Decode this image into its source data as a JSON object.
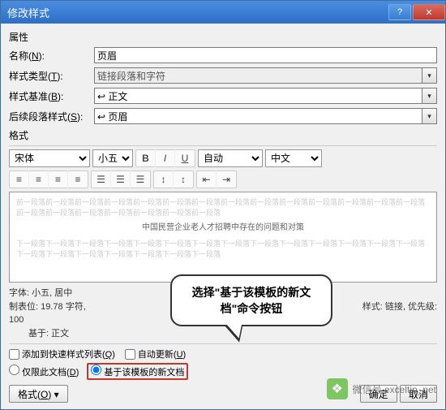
{
  "titlebar": {
    "title": "修改样式"
  },
  "labels": {
    "prop": "属性",
    "name": "名称(N):",
    "styleType": "样式类型(T):",
    "basedOn": "样式基准(B):",
    "following": "后续段落样式(S):",
    "format": "格式",
    "addToQuick": "添加到快速样式列表(Q)",
    "autoUpdate": "自动更新(U)",
    "onlyThisDoc": "仅限此文档(D)",
    "basedOnTemplate": "基于该模板的新文档",
    "ok": "确定",
    "cancel": "取消",
    "formatBtn": "格式(O)"
  },
  "values": {
    "name": "页眉",
    "styleType": "链接段落和字符",
    "basedOn": "↩ 正文",
    "following": "↩ 页眉",
    "font": "宋体",
    "size": "小五",
    "colorAuto": "自动",
    "langCn": "中文"
  },
  "preview": {
    "before": "前一段落前一段落前一段落前一段落前一段落前一段落前一段落前一段落前一段落前一段落前一段落前一段落前一段落前一段落前一段落前一段落前一段落前一段落前一段落前一段落前一段落",
    "center": "中国民营企业老人才招聘中存在的问题和对策",
    "after": "下一段落下一段落下一段落下一段落下一段落下一段落下一段落下一段落下一段落下一段落下一段落下一段落下一段落下一段落下一段落下一段落下一段落下一段落下一段落下一段落下一段落"
  },
  "info": {
    "line1": "字体: 小五, 居中",
    "line2_a": "制表位: 19.78 字符,",
    "line2_b": "样式: 链接, 优先级:",
    "line3": "100",
    "line4": "基于: 正文"
  },
  "callout": "选择\"基于该模板的新文档\"命令按钮",
  "wm": "微信号 exceltip_net"
}
